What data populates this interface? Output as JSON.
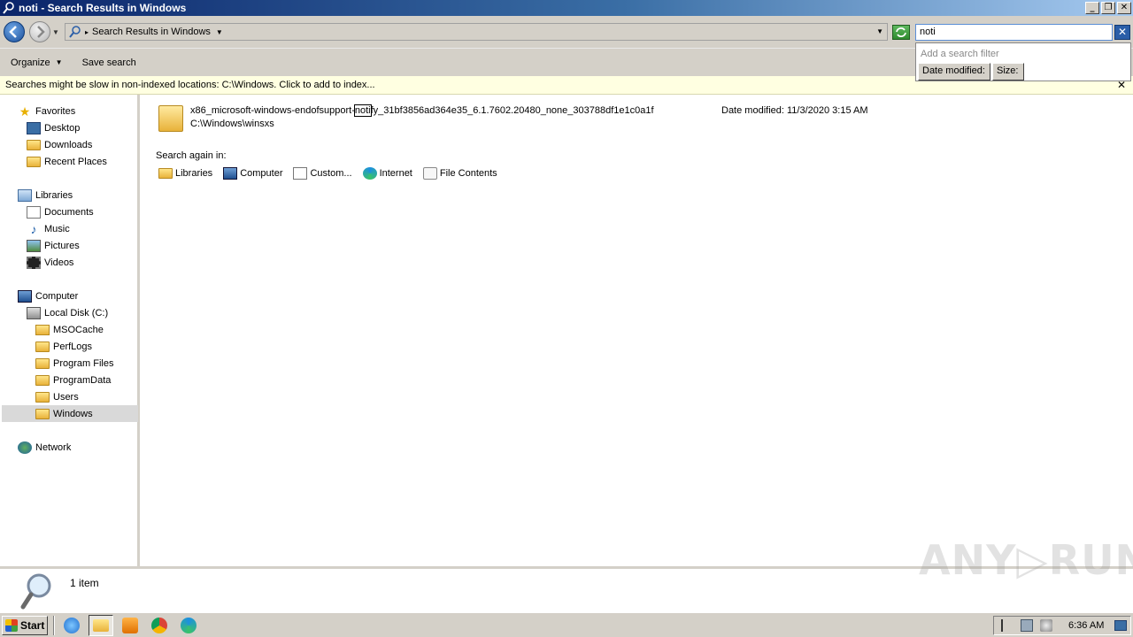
{
  "window": {
    "title": "noti - Search Results in Windows",
    "min_label": "_",
    "restore_label": "❐",
    "close_label": "✕"
  },
  "address": {
    "crumb": "Search Results in Windows"
  },
  "search": {
    "query": "noti",
    "filter_hint": "Add a search filter",
    "filter_date": "Date modified:",
    "filter_size": "Size:"
  },
  "toolbar": {
    "organize": "Organize",
    "save_search": "Save search"
  },
  "infobar": {
    "message": "Searches might be slow in non-indexed locations: C:\\Windows. Click to add to index...",
    "close": "✕"
  },
  "nav": {
    "favorites": "Favorites",
    "desktop": "Desktop",
    "downloads": "Downloads",
    "recent": "Recent Places",
    "libraries": "Libraries",
    "documents": "Documents",
    "music": "Music",
    "pictures": "Pictures",
    "videos": "Videos",
    "computer": "Computer",
    "local_disk": "Local Disk (C:)",
    "msocache": "MSOCache",
    "perflogs": "PerfLogs",
    "program_files": "Program Files",
    "programdata": "ProgramData",
    "users": "Users",
    "windows": "Windows",
    "network": "Network"
  },
  "result": {
    "name_prefix": "x86_microsoft-windows-endofsupport-",
    "name_match": "noti",
    "name_suffix": "fy_31bf3856ad364e35_6.1.7602.20480_none_303788df1e1c0a1f",
    "path": "C:\\Windows\\winsxs",
    "date": "Date modified: 11/3/2020 3:15 AM"
  },
  "search_again": {
    "label": "Search again in:",
    "libraries": "Libraries",
    "computer": "Computer",
    "custom": "Custom...",
    "internet": "Internet",
    "file_contents": "File Contents"
  },
  "status": {
    "count": "1 item"
  },
  "watermark": "ANY▷RUN",
  "taskbar": {
    "start": "Start",
    "clock": "6:36 AM"
  }
}
